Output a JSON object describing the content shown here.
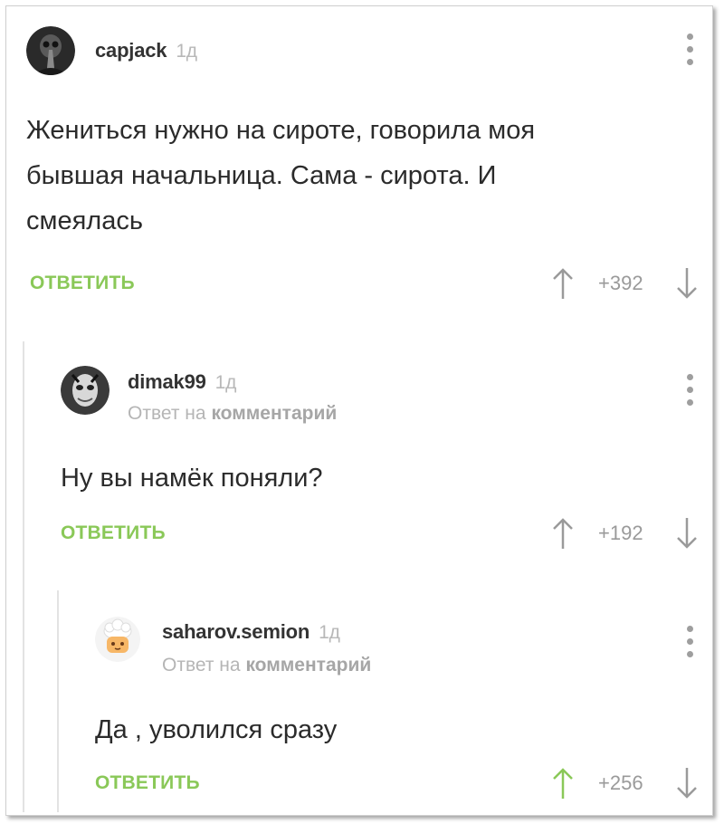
{
  "comments": [
    {
      "username": "capjack",
      "time": "1д",
      "text_lines": [
        "Жениться нужно на сироте, говорила моя",
        "бывшая начальница. Сама - сирота. И",
        "смеялась"
      ],
      "reply_label": "ОТВЕТИТЬ",
      "score": "+392",
      "avatar_icon": "plague-doctor-avatar",
      "colors": {
        "up_arrow": "#9a9a9a"
      }
    },
    {
      "username": "dimak99",
      "time": "1д",
      "reply_to_prefix": "Ответ на",
      "reply_to_link": "комментарий",
      "text": "Ну вы намёк поняли?",
      "reply_label": "ОТВЕТИТЬ",
      "score": "+192",
      "avatar_icon": "masked-face-avatar",
      "colors": {
        "up_arrow": "#9a9a9a"
      }
    },
    {
      "username": "saharov.semion",
      "time": "1д",
      "reply_to_prefix": "Ответ на",
      "reply_to_link": "комментарий",
      "text": "Да , уволился сразу",
      "reply_label": "ОТВЕТИТЬ",
      "score": "+256",
      "avatar_icon": "chef-cartoon-avatar",
      "colors": {
        "up_arrow": "#8ac858"
      }
    }
  ],
  "theme": {
    "accent": "#8ac858",
    "muted": "#b5b5b5"
  }
}
